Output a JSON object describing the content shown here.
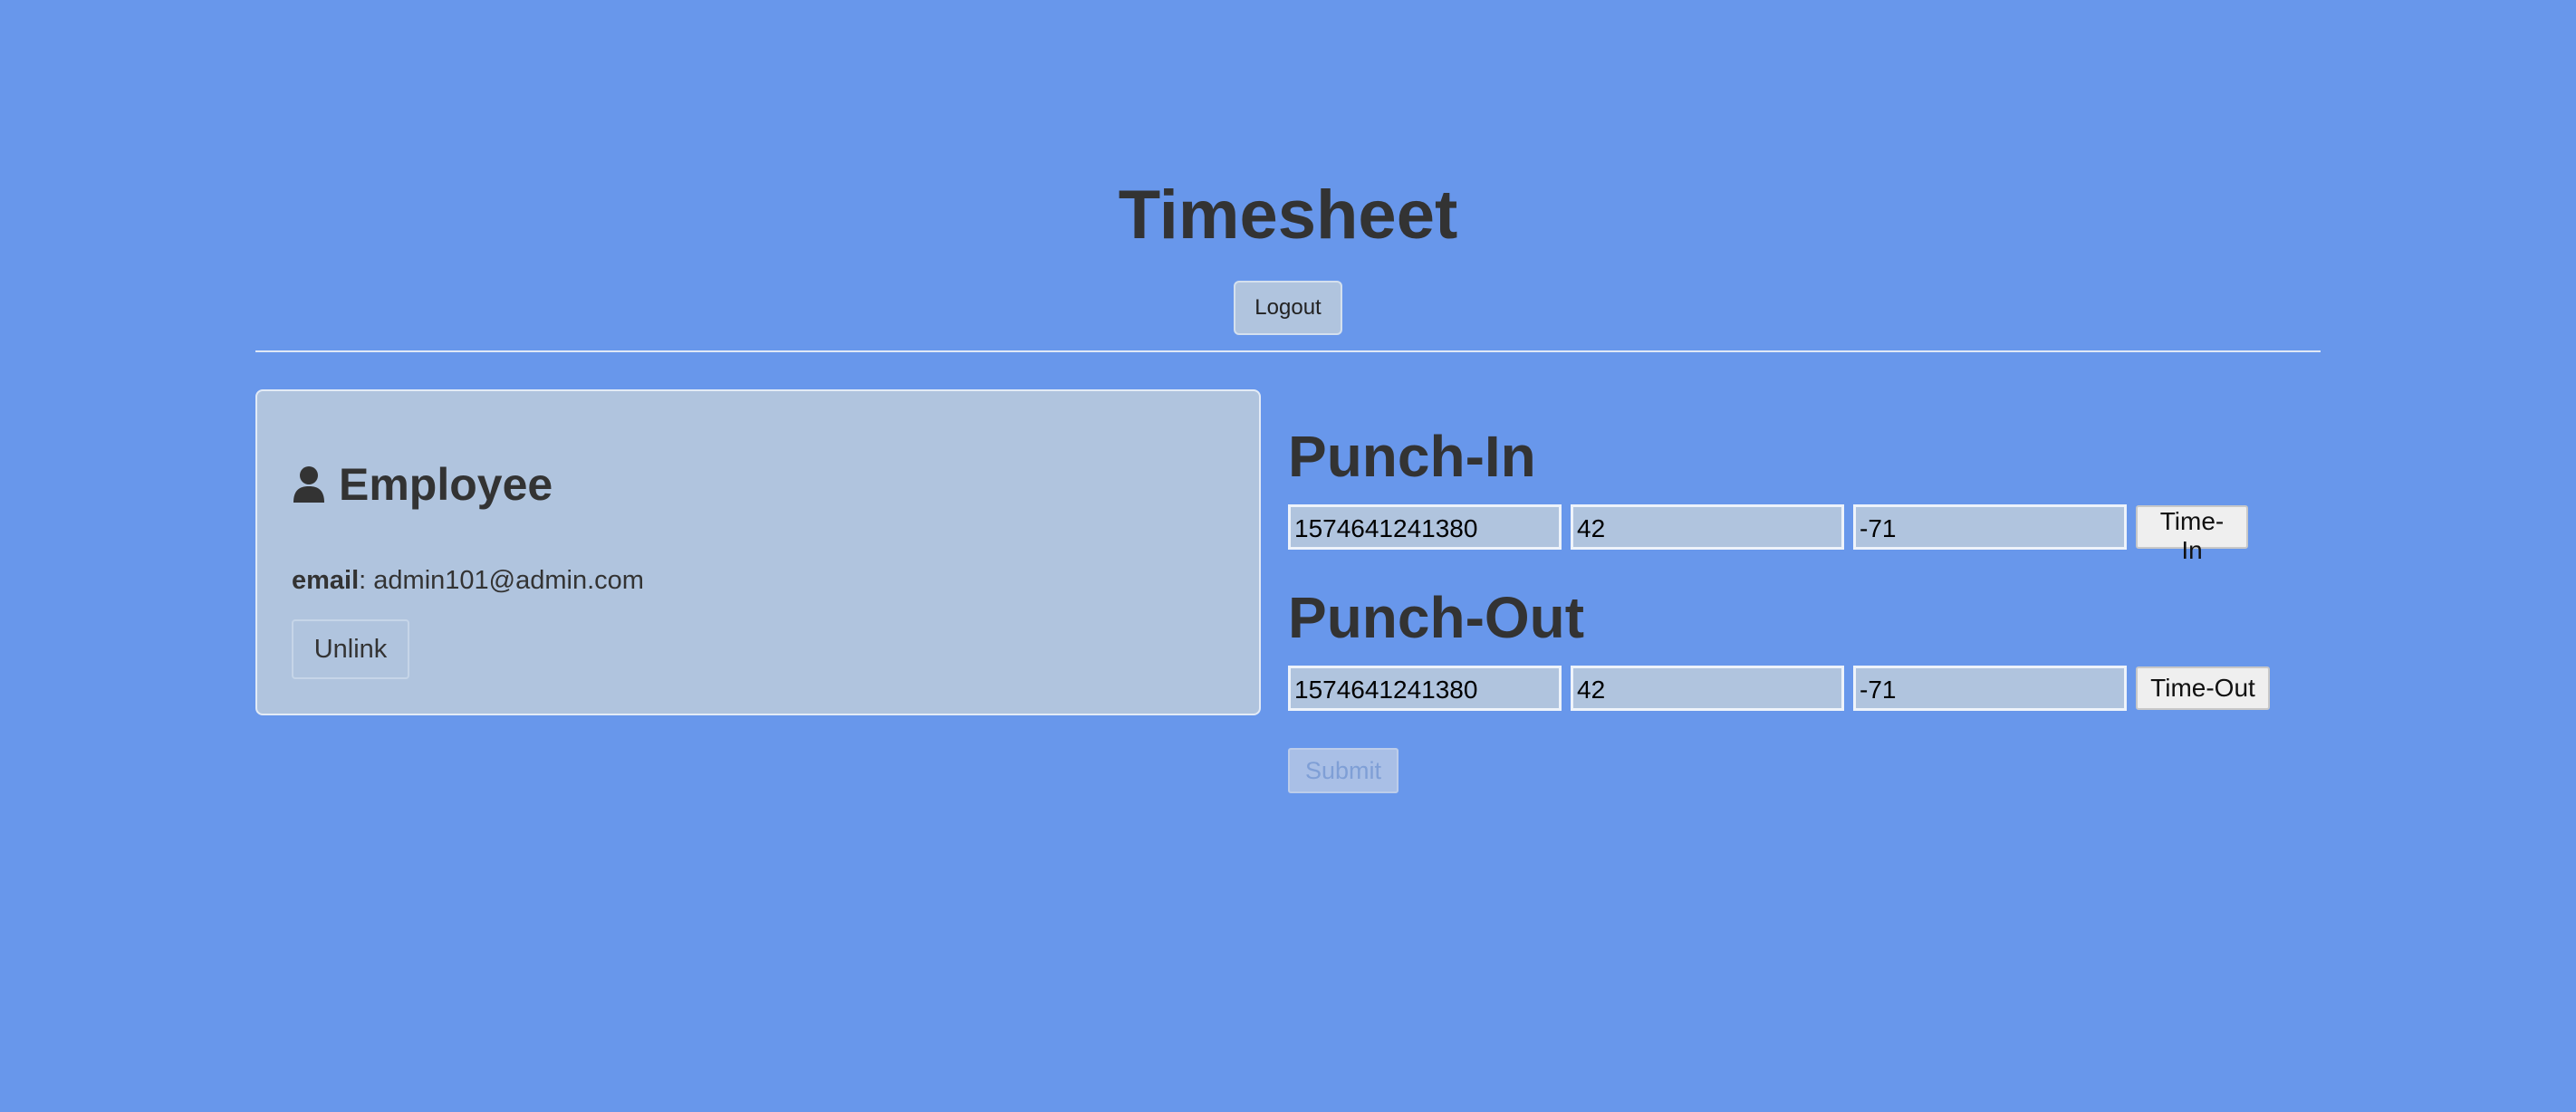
{
  "header": {
    "title": "Timesheet",
    "logout_label": "Logout"
  },
  "employee_card": {
    "icon": "user-icon",
    "heading": "Employee",
    "email_label": "email",
    "email_separator": ":",
    "email_value": "admin101@admin.com",
    "unlink_label": "Unlink"
  },
  "punch_in": {
    "title": "Punch-In",
    "timestamp": "1574641241380",
    "latitude": "42",
    "longitude": "-71",
    "button_label": "Time-In"
  },
  "punch_out": {
    "title": "Punch-Out",
    "timestamp": "1574641241380",
    "latitude": "42",
    "longitude": "-71",
    "button_label": "Time-Out"
  },
  "submit_label": "Submit",
  "colors": {
    "background": "#6897eb",
    "panel": "#b0c4de",
    "text": "#333333"
  }
}
